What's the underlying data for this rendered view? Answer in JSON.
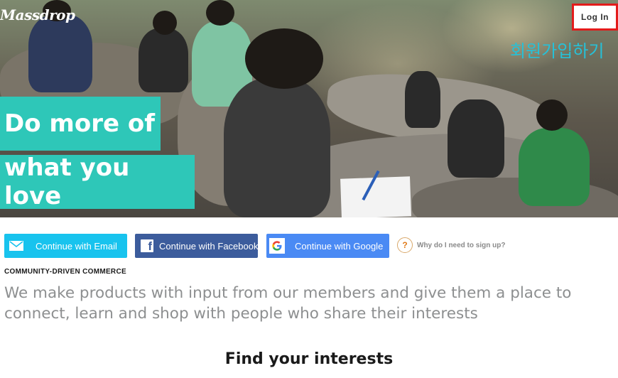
{
  "header": {
    "logo_text": "Massdrop",
    "login_label": "Log In",
    "korean_annotation": "회원가입하기"
  },
  "hero": {
    "tagline_line1": "Do more of",
    "tagline_line2": "what you love"
  },
  "signup": {
    "email_label": "Continue with Email",
    "facebook_label": "Continue with Facebook",
    "google_label": "Continue with Google",
    "why_label": "Why do I need to sign up?",
    "why_icon": "?"
  },
  "about": {
    "kicker": "COMMUNITY-DRIVEN COMMERCE",
    "description": "We make products with input from our members and give them a place to connect, learn and shop with people who share their interests"
  },
  "interests": {
    "title": "Find your interests"
  },
  "icons": {
    "email": "envelope-icon",
    "facebook": "facebook-icon",
    "google": "google-icon",
    "help": "question-icon"
  },
  "colors": {
    "teal_accent": "#2ec7b8",
    "email_blue": "#18c3ee",
    "facebook_blue": "#3c5c9c",
    "google_blue": "#4a8af4",
    "highlight_red": "#e31b1b",
    "annotation_cyan": "#26c1d8"
  }
}
